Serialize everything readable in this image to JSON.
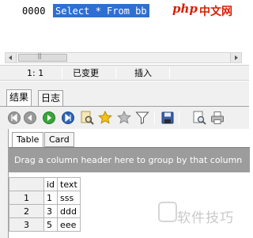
{
  "editor": {
    "line_number": "0000",
    "code": "Select * From bb"
  },
  "brand": {
    "logo_php": "php",
    "logo_cn": "中文网"
  },
  "statusbar": {
    "position": "1:  1",
    "modified": "已变更",
    "mode": "插入"
  },
  "result_tabs": [
    {
      "label": "结果",
      "active": true
    },
    {
      "label": "日志",
      "active": false
    }
  ],
  "toolbar_icons": [
    "first-record-icon",
    "previous-record-icon",
    "next-record-icon",
    "last-record-icon",
    "find-icon",
    "favorite-icon",
    "favorite-add-icon",
    "filter-icon",
    "save-icon",
    "print-preview-icon",
    "print-icon"
  ],
  "view_tabs": [
    {
      "label": "Table",
      "active": true
    },
    {
      "label": "Card",
      "active": false
    }
  ],
  "group_bar": {
    "text": "Drag a column header here to group by that column"
  },
  "grid": {
    "columns": [
      "id",
      "text"
    ],
    "rows": [
      {
        "num": "1",
        "id": "1",
        "text": "sss"
      },
      {
        "num": "2",
        "id": "3",
        "text": "ddd"
      },
      {
        "num": "3",
        "id": "5",
        "text": "eee"
      }
    ]
  },
  "watermark": {
    "text": "软件技巧"
  },
  "colors": {
    "selection": "#2f6fd0",
    "brand_red": "#d81e06",
    "group_bar": "#9c9c9c"
  }
}
